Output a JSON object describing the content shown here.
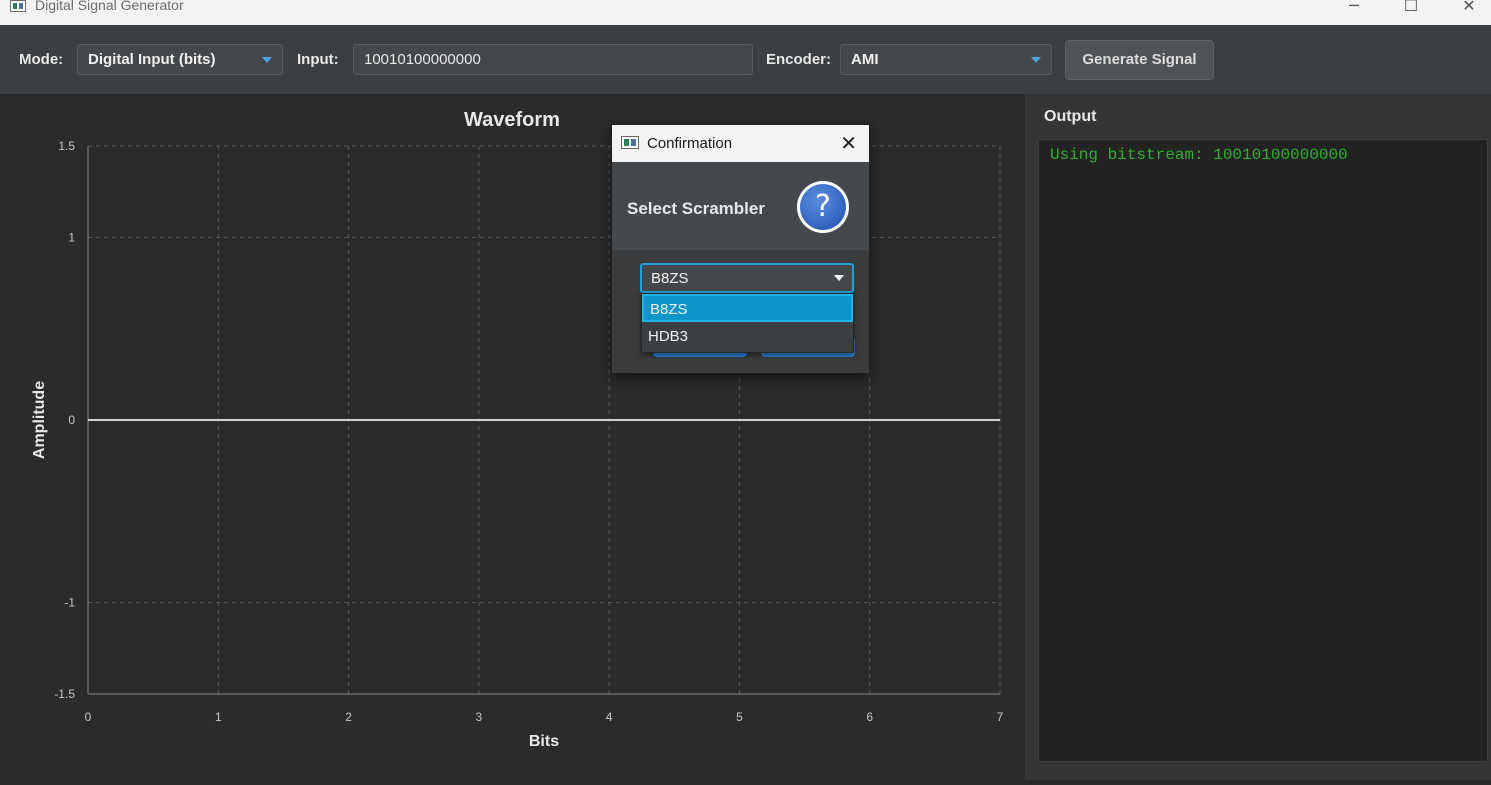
{
  "window": {
    "title": "Digital Signal Generator",
    "minimize_icon": "minimize-icon",
    "maximize_icon": "maximize-icon",
    "close_icon": "close-icon"
  },
  "toolbar": {
    "mode_label": "Mode:",
    "mode_value": "Digital Input (bits)",
    "input_label": "Input:",
    "input_value": "10010100000000",
    "encoder_label": "Encoder:",
    "encoder_value": "AMI",
    "generate_label": "Generate Signal"
  },
  "output": {
    "label": "Output",
    "lines": [
      "Using bitstream: 10010100000000"
    ],
    "text_color": "#2fb12f"
  },
  "dialog": {
    "title": "Confirmation",
    "header": "Select Scrambler",
    "icon": "help-icon",
    "selected": "B8ZS",
    "options": [
      "B8ZS",
      "HDB3"
    ],
    "highlighted_option": "B8ZS"
  },
  "colors": {
    "accent": "#1fa0d8",
    "dropdown_arrow": "#4aa3df",
    "signal": "#d0d0d0"
  },
  "chart_data": {
    "type": "line",
    "title": "Waveform",
    "xlabel": "Bits",
    "ylabel": "Amplitude",
    "xlim": [
      0,
      7
    ],
    "ylim": [
      -1.5,
      1.5
    ],
    "x_ticks": [
      "0",
      "1",
      "2",
      "3",
      "4",
      "5",
      "6",
      "7"
    ],
    "y_ticks": [
      "1.5",
      "1",
      "0",
      "-1",
      "-1.5"
    ],
    "y_tick_values": [
      1.5,
      1,
      0,
      -1,
      -1.5
    ],
    "grid": true,
    "series": [
      {
        "x": [
          0,
          7
        ],
        "y": [
          0,
          0
        ]
      }
    ]
  }
}
